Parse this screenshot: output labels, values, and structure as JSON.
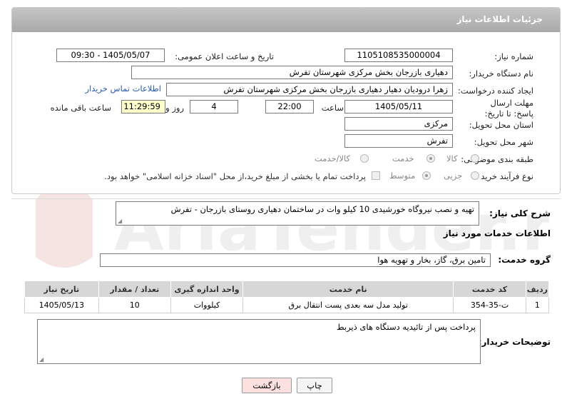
{
  "header": {
    "title": "جزئیات اطلاعات نیاز"
  },
  "need_number": {
    "label": "شماره نیاز:",
    "value": "1105108535000004"
  },
  "announce": {
    "label": "تاریخ و ساعت اعلان عمومی:",
    "value": "1405/05/07 - 09:30"
  },
  "buyer_org": {
    "label": "نام دستگاه خریدار:",
    "value": "دهیاری بازرجان بخش مرکزی شهرستان تفرش"
  },
  "creator": {
    "label": "ایجاد کننده درخواست:",
    "value": "زهرا درودیان دهیار دهیاری بازرجان بخش مرکزی شهرستان تفرش",
    "contact_link": "اطلاعات تماس خریدار"
  },
  "deadline": {
    "label": "مهلت ارسال پاسخ: تا تاریخ:",
    "date": "1405/05/11",
    "time_label": "ساعت",
    "time": "22:00",
    "days": "4",
    "days_label": "روز و",
    "remaining": "11:29:59",
    "remaining_label": "ساعت باقی مانده"
  },
  "province": {
    "label": "استان محل تحویل:",
    "value": "مرکزی"
  },
  "city": {
    "label": "شهر محل تحویل:",
    "value": "تفرش"
  },
  "category": {
    "label": "طبقه بندی موضوعی:",
    "options": [
      "کالا",
      "خدمت",
      "کالا/خدمت"
    ],
    "selected": "خدمت"
  },
  "purchase_type": {
    "label": "نوع فرآیند خرید :",
    "options": [
      "جزیی",
      "متوسط"
    ],
    "selected": "متوسط",
    "note": "پرداخت تمام یا بخشی از مبلغ خرید،از محل \"اسناد خزانه اسلامی\" خواهد بود."
  },
  "description": {
    "label": "شرح کلی نیاز:",
    "value": "تهیه و نصب نیروگاه خورشیدی 10 کیلو وات در ساختمان دهیاری روستای بازرجان - تفرش"
  },
  "services_title": "اطلاعات خدمات مورد نیاز",
  "service_group": {
    "label": "گروه خدمت:",
    "value": "تامین برق، گاز، بخار و تهویه هوا"
  },
  "table": {
    "headers": [
      "ردیف",
      "کد خدمت",
      "نام خدمت",
      "واحد اندازه گیری",
      "تعداد / مقدار",
      "تاریخ نیاز"
    ],
    "rows": [
      [
        "1",
        "ت-35-354",
        "تولید مدل سه بعدی پست انتقال برق",
        "کیلووات",
        "10",
        "1405/05/13"
      ]
    ]
  },
  "buyer_notes": {
    "label": "توضیحات خریدار:",
    "value": "پرداخت پس از تائیدیه دستگاه های ذیربط"
  },
  "buttons": {
    "print": "چاپ",
    "back": "بازگشت"
  },
  "watermark": "AriaTender.net",
  "colors": {
    "header": "#b4b4b4",
    "link": "#2a5db0",
    "remaining_bg": "#ffffcc",
    "back_bg": "#fde0e0"
  }
}
